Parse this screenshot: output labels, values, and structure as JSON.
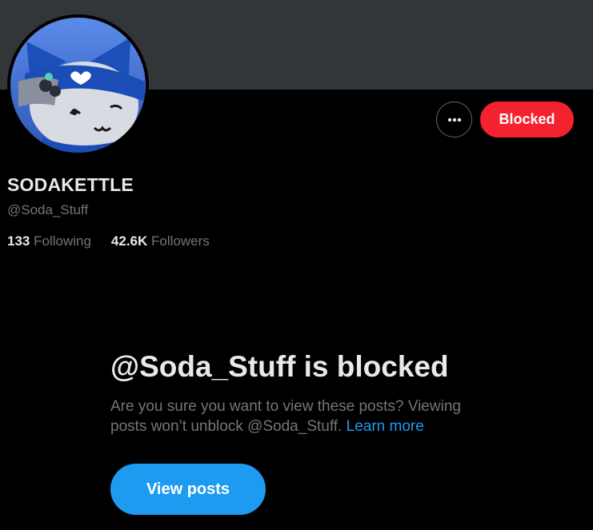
{
  "profile": {
    "display_name": "SODAKETTLE",
    "handle": "@Soda_Stuff",
    "following_count": "133",
    "following_label": "Following",
    "followers_count": "42.6K",
    "followers_label": "Followers"
  },
  "actions": {
    "more_icon": "more-horizontal-icon",
    "blocked_label": "Blocked"
  },
  "blocked_notice": {
    "title": "@Soda_Stuff is blocked",
    "description": "Are you sure you want to view these posts? Viewing posts won’t unblock @Soda_Stuff.",
    "learn_more": "Learn more",
    "view_posts_label": "View posts"
  },
  "colors": {
    "background": "#000000",
    "banner": "#333639",
    "blocked_red": "#f4212e",
    "accent_blue": "#1d9bf0",
    "muted_text": "#71767b",
    "primary_text": "#e7e9ea"
  }
}
